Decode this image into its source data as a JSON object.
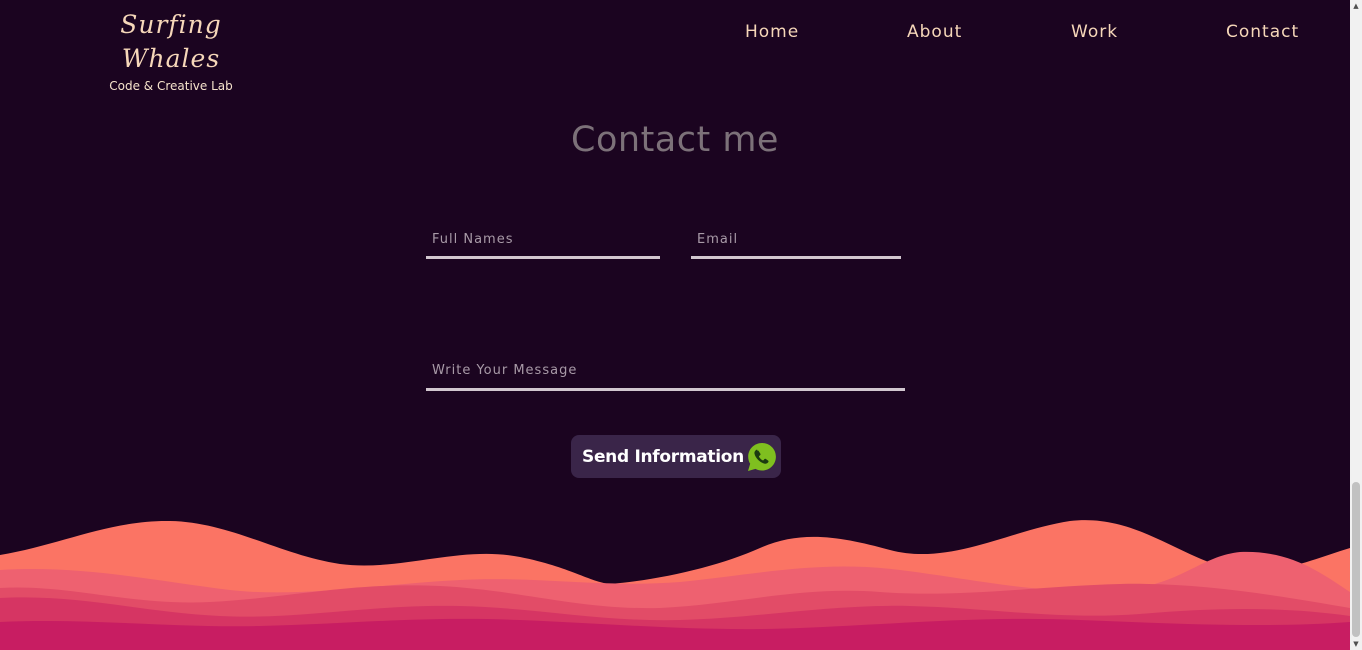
{
  "brand": {
    "title": "Surfing Whales",
    "subtitle": "Code & Creative Lab"
  },
  "nav": {
    "home": "Home",
    "about": "About",
    "work": "Work",
    "contact": "Contact"
  },
  "main": {
    "title": "Contact me",
    "full_name_placeholder": "Full Names",
    "email_placeholder": "Email",
    "message_placeholder": "Write Your Message",
    "full_name_value": "",
    "email_value": "",
    "message_value": "",
    "send_label": "Send Information",
    "send_icon": "whatsapp-icon"
  },
  "colors": {
    "background": "#1b0420",
    "accent": "#f6d7b9",
    "button": "#3a2549",
    "wave_light": "#fb7464",
    "wave_dark": "#c81d62"
  }
}
